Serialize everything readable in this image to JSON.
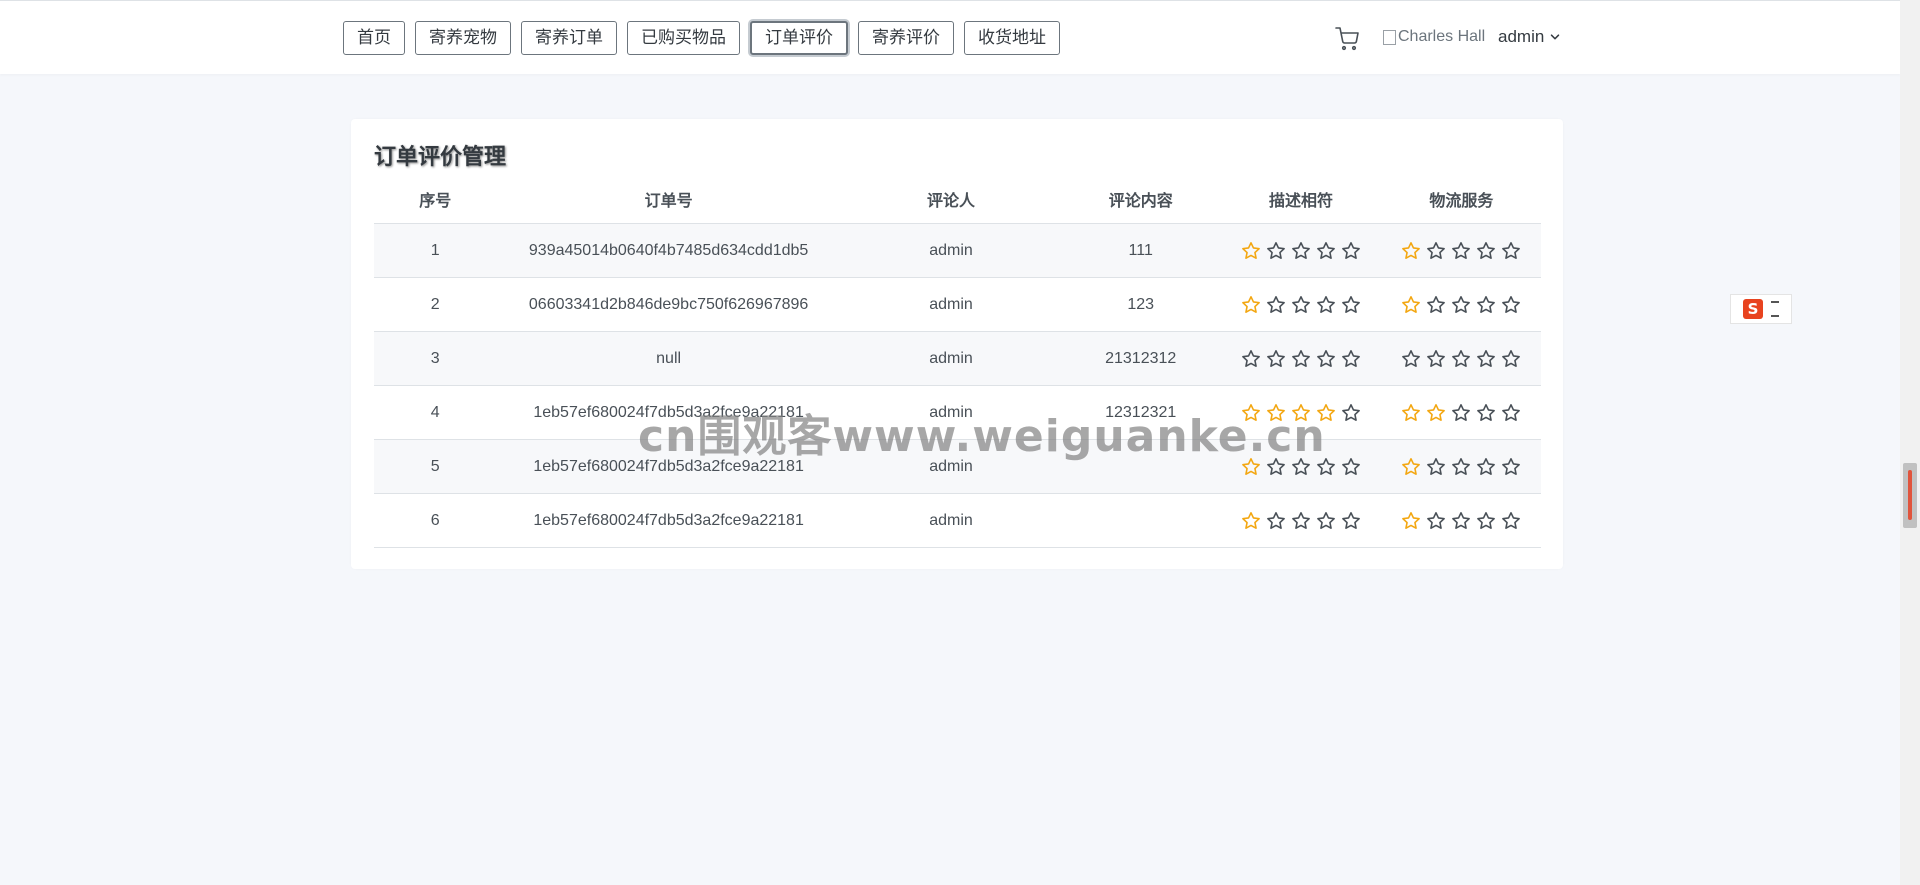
{
  "nav": {
    "items": [
      {
        "label": "首页"
      },
      {
        "label": "寄养宠物"
      },
      {
        "label": "寄养订单"
      },
      {
        "label": "已购买物品"
      },
      {
        "label": "订单评价"
      },
      {
        "label": "寄养评价"
      },
      {
        "label": "收货地址"
      }
    ],
    "active": "订单评价"
  },
  "header": {
    "cart_icon": "cart-icon",
    "avatar_alt": "Charles Hall",
    "username": "admin"
  },
  "card": {
    "title": "订单评价管理"
  },
  "table": {
    "columns": [
      "序号",
      "订单号",
      "评论人",
      "评论内容",
      "描述相符",
      "物流服务"
    ],
    "rows": [
      {
        "index": "1",
        "order_no": "939a45014b0640f4b7485d634cdd1db5",
        "reviewer": "admin",
        "content": "111",
        "description_rating": 1,
        "logistics_rating": 1
      },
      {
        "index": "2",
        "order_no": "06603341d2b846de9bc750f626967896",
        "reviewer": "admin",
        "content": "123",
        "description_rating": 1,
        "logistics_rating": 1
      },
      {
        "index": "3",
        "order_no": "null",
        "reviewer": "admin",
        "content": "21312312",
        "description_rating": 0,
        "logistics_rating": 0
      },
      {
        "index": "4",
        "order_no": "1eb57ef680024f7db5d3a2fce9a22181",
        "reviewer": "admin",
        "content": "12312321",
        "description_rating": 4,
        "logistics_rating": 2
      },
      {
        "index": "5",
        "order_no": "1eb57ef680024f7db5d3a2fce9a22181",
        "reviewer": "admin",
        "content": "",
        "description_rating": 1,
        "logistics_rating": 1
      },
      {
        "index": "6",
        "order_no": "1eb57ef680024f7db5d3a2fce9a22181",
        "reviewer": "admin",
        "content": "",
        "description_rating": 1,
        "logistics_rating": 1
      }
    ],
    "max_rating": 5
  },
  "colors": {
    "star_on": "#f3a712",
    "star_off": "#495057",
    "page_background": "#f5f7fb"
  },
  "watermark": "cn围观客www.weiguanke.cn",
  "float_widget": {
    "icon": "sogou-ime-icon",
    "letter": "S"
  }
}
